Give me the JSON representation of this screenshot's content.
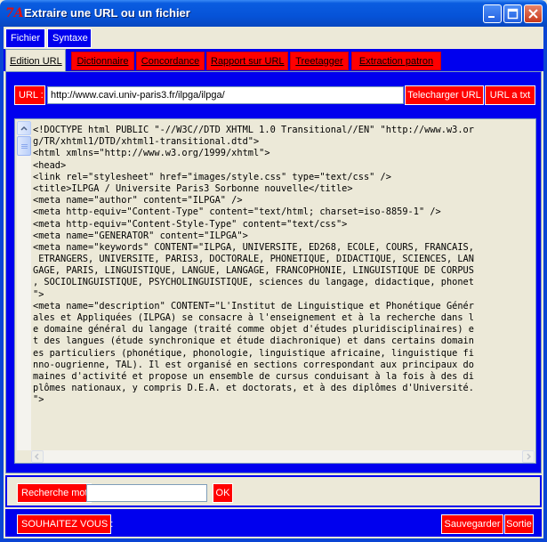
{
  "window": {
    "title": "Extraire une URL ou un fichier",
    "icon_glyph": "7A"
  },
  "menu": {
    "items": [
      "Fichier",
      "Syntaxe"
    ]
  },
  "tabs": [
    {
      "label": "Edition URL",
      "active": true
    },
    {
      "label": "Dictionnaire",
      "active": false
    },
    {
      "label": "Concordance",
      "active": false
    },
    {
      "label": "Rapport sur URL",
      "active": false
    },
    {
      "label": "Treetagger",
      "active": false
    },
    {
      "label": "Extraction patron",
      "active": false
    }
  ],
  "url_bar": {
    "label": "URL :",
    "value": "http://www.cavi.univ-paris3.fr/ilpga/ilpga/",
    "download_button": "Telecharger URL",
    "to_txt_button": "URL a txt"
  },
  "source_lines": [
    "<!DOCTYPE html PUBLIC \"-//W3C//DTD XHTML 1.0 Transitional//EN\" \"http://www.w3.or",
    "g/TR/xhtml1/DTD/xhtml1-transitional.dtd\">",
    "<html xmlns=\"http://www.w3.org/1999/xhtml\">",
    "<head>",
    "<link rel=\"stylesheet\" href=\"images/style.css\" type=\"text/css\" />",
    "<title>ILPGA / Universite Paris3 Sorbonne nouvelle</title>",
    "<meta name=\"author\" content=\"ILPGA\" />",
    "<meta http-equiv=\"Content-Type\" content=\"text/html; charset=iso-8859-1\" />",
    "<meta http-equiv=\"Content-Style-Type\" content=\"text/css\">",
    "<meta name=\"GENERATOR\" content=\"ILPGA\">",
    "<meta name=\"keywords\" CONTENT=\"ILPGA, UNIVERSITE, ED268, ECOLE, COURS, FRANCAIS,",
    " ETRANGERS, UNIVERSITE, PARIS3, DOCTORALE, PHONETIQUE, DIDACTIQUE, SCIENCES, LAN",
    "GAGE, PARIS, LINGUISTIQUE, LANGUE, LANGAGE, FRANCOPHONIE, LINGUISTIQUE DE CORPUS",
    ", SOCIOLINGUISTIQUE, PSYCHOLINGUISTIQUE, sciences du langage, didactique, phonet",
    "\">",
    "<meta name=\"description\" CONTENT=\"L'Institut de Linguistique et Phonétique Génér",
    "ales et Appliquées (ILPGA) se consacre à l'enseignement et à la recherche dans l",
    "e domaine général du langage (traité comme objet d'études pluridisciplinaires) e",
    "t des langues (étude synchronique et étude diachronique) et dans certains domain",
    "es particuliers (phonétique, phonologie, linguistique africaine, linguistique fi",
    "nno-ougrienne, TAL). Il est organisé en sections correspondant aux principaux do",
    "maines d'activité et propose un ensemble de cursus conduisant à la fois à des di",
    "plômes nationaux, y compris D.E.A. et doctorats, et à des diplômes d'Université.",
    "\">"
  ],
  "search": {
    "label": "Recherche mot:",
    "value": "",
    "ok_button": "OK"
  },
  "footer": {
    "prompt": "SOUHAITEZ VOUS :",
    "save_button": "Sauvegarder",
    "exit_button": "Sortie"
  },
  "colors": {
    "accent_blue": "#0000ee",
    "button_red": "#ff0000",
    "panel_bg": "#ece9d8"
  }
}
